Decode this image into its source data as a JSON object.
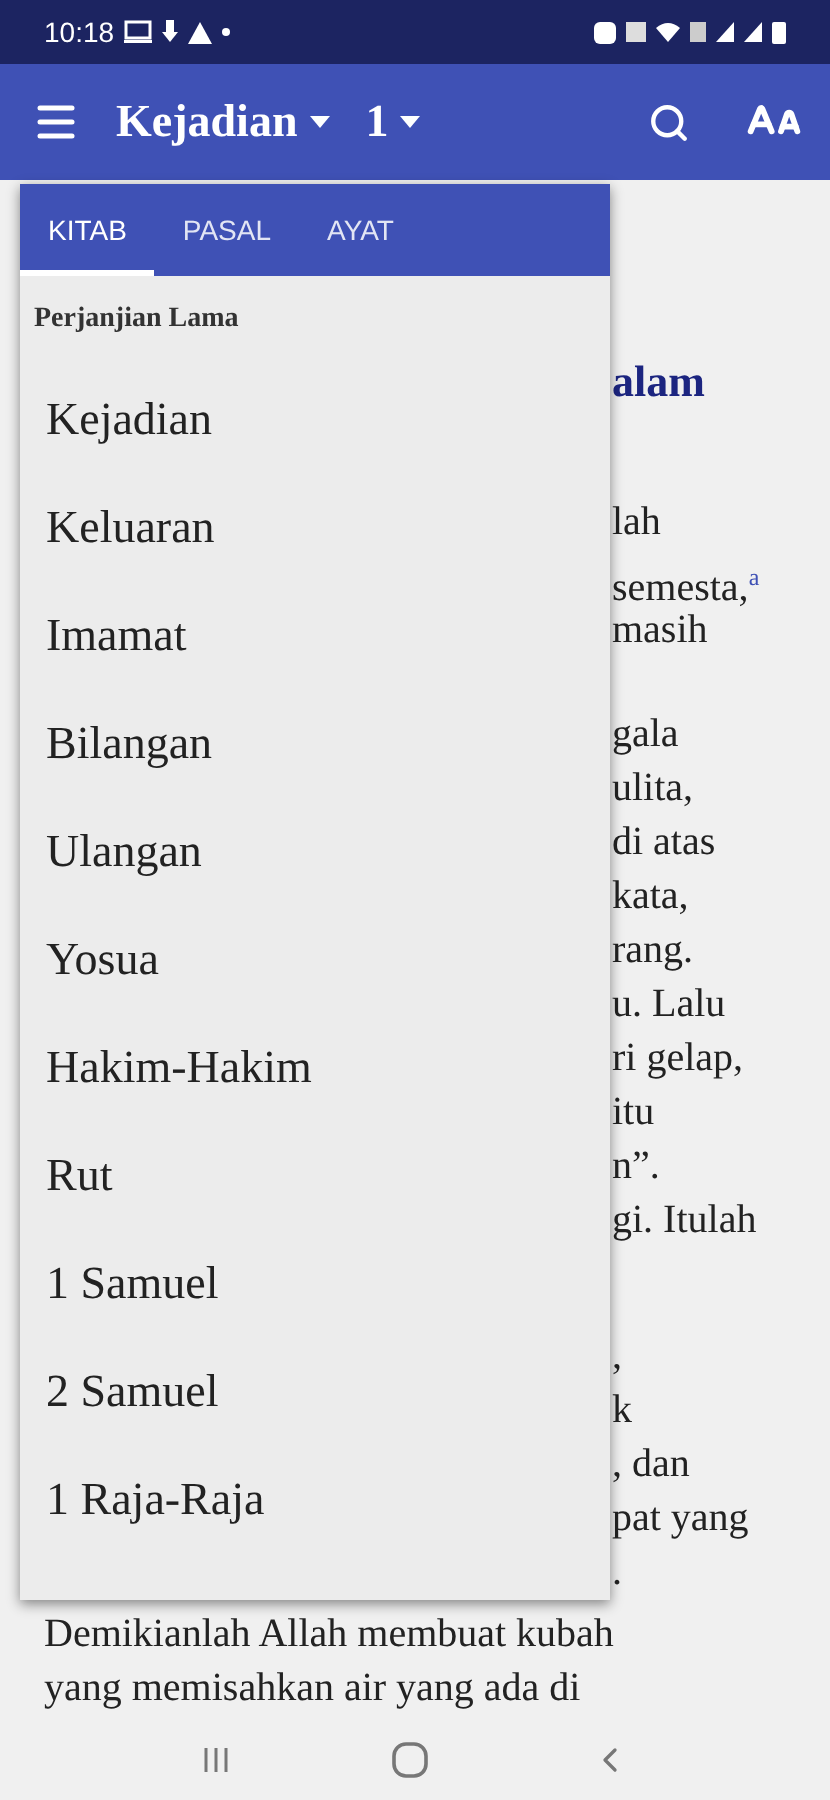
{
  "status_bar": {
    "time": "10:18"
  },
  "app_bar": {
    "book": "Kejadian",
    "chapter": "1"
  },
  "passage": {
    "heading": "alam",
    "fragments": [
      [
        "lah",
        "semesta,$^{a}$",
        "masih"
      ],
      [
        "gala",
        "ulita,",
        "di atas",
        "kata,",
        "rang.",
        "u. Lalu",
        "ri gelap,",
        "itu",
        "n”.",
        "gi. Itulah"
      ],
      [
        ",",
        "k",
        ", dan",
        "pat yang",
        "."
      ]
    ],
    "lines": [
      "Demikianlah Allah membuat kubah",
      "yang memisahkan air yang ada di"
    ]
  },
  "picker": {
    "tabs": [
      {
        "label": "KITAB",
        "selected": true
      },
      {
        "label": "PASAL",
        "selected": false
      },
      {
        "label": "AYAT",
        "selected": false
      }
    ],
    "section": "Perjanjian Lama",
    "books": [
      "Kejadian",
      "Keluaran",
      "Imamat",
      "Bilangan",
      "Ulangan",
      "Yosua",
      "Hakim-Hakim",
      "Rut",
      "1 Samuel",
      "2 Samuel",
      "1 Raja-Raja"
    ]
  }
}
